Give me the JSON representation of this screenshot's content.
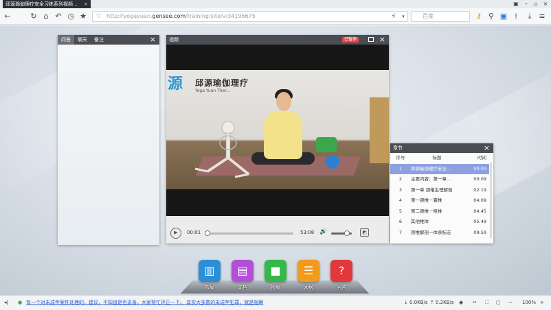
{
  "browser": {
    "tab_title": "邱源瑜伽理疗安全习练系列视频...",
    "url_prefix": "http://yogayuan.",
    "url_host": "gensee.com",
    "url_path": "/training/site/v/34196675",
    "search_placeholder": "百度"
  },
  "qa_panel": {
    "tabs": [
      "问答",
      "聊天",
      "备注"
    ]
  },
  "video_panel": {
    "title": "视频",
    "paused_badge": "已暂停",
    "logo_mark": "源",
    "logo_text": "邱源瑜伽理疗",
    "logo_sub": "Yoga Yuan Ther...",
    "current_time": "00:01",
    "duration": "53:08",
    "progress_fraction": 0.0003,
    "volume_fraction": 0.75
  },
  "chapters": {
    "title": "章节",
    "headers": {
      "num": "序号",
      "title": "标题",
      "time": "时间"
    },
    "rows": [
      {
        "num": "1",
        "title": "邱源瑜伽理疗安全...",
        "time": "00:00"
      },
      {
        "num": "2",
        "title": "主要内容：第一章...",
        "time": "00:09"
      },
      {
        "num": "3",
        "title": "第一章 颈椎生理解剖",
        "time": "02:19"
      },
      {
        "num": "4",
        "title": "第一颈椎－寰椎",
        "time": "04:09"
      },
      {
        "num": "5",
        "title": "第二颈椎－枢椎",
        "time": "04:45"
      },
      {
        "num": "6",
        "title": "其他椎体",
        "time": "05:49"
      },
      {
        "num": "7",
        "title": "颈椎解剖一体表标志",
        "time": "09:59"
      }
    ]
  },
  "dock": [
    {
      "label": "布局",
      "icon": "layout-icon",
      "color": "#2b8fd6",
      "glyph": "▥"
    },
    {
      "label": "文档",
      "icon": "document-icon",
      "color": "#b14fd6",
      "glyph": "▤"
    },
    {
      "label": "视频",
      "icon": "video-camera-icon",
      "color": "#34b84a",
      "glyph": "■"
    },
    {
      "label": "大纲",
      "icon": "outline-icon",
      "color": "#f29a1c",
      "glyph": "☰"
    },
    {
      "label": "问答",
      "icon": "question-icon",
      "color": "#e0383b",
      "glyph": "?"
    }
  ],
  "statusbar": {
    "notice": "有一个对未成年案件处理的，建议，不知道是否妥善，大家帮忙评正一下。 其实大多数的未成年犯罪，就是隐瞒",
    "down_speed": "0.0KB/s",
    "up_speed": "0.2KB/s",
    "zoom": "100%"
  }
}
